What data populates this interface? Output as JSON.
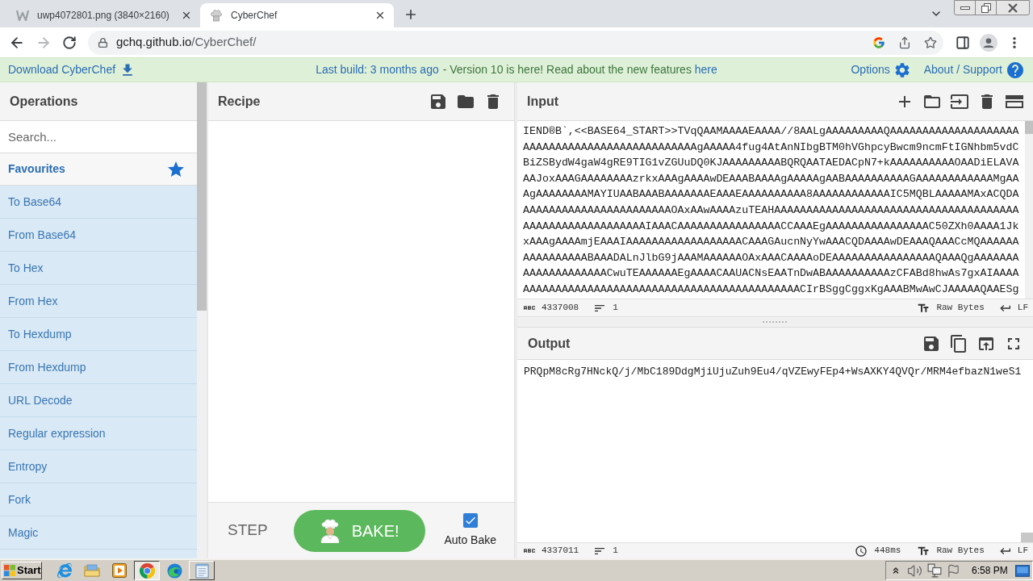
{
  "browser": {
    "tabs": [
      {
        "kind": "image",
        "title": "uwp4072801.png (3840×2160)",
        "selected": false
      },
      {
        "kind": "chef",
        "title": "CyberChef",
        "selected": true
      }
    ],
    "url_host": "gchq.github.io",
    "url_path": "/CyberChef/",
    "forward_disabled": true
  },
  "banner": {
    "download": "Download CyberChef",
    "build": "Last build: 3 months ago",
    "notice": "- Version 10 is here! Read about the new features",
    "notice_link": "here",
    "options": "Options",
    "about": "About / Support"
  },
  "operations": {
    "title": "Operations",
    "search_placeholder": "Search...",
    "favourites": "Favourites",
    "items": [
      "To Base64",
      "From Base64",
      "To Hex",
      "From Hex",
      "To Hexdump",
      "From Hexdump",
      "URL Decode",
      "Regular expression",
      "Entropy",
      "Fork",
      "Magic"
    ]
  },
  "recipe": {
    "title": "Recipe",
    "step": "STEP",
    "bake": "BAKE!",
    "auto_bake": {
      "label": "Auto Bake",
      "checked": true
    }
  },
  "input": {
    "title": "Input",
    "lines": [
      "IEND®B`,<<BASE64_START>>TVqQAAMAAAAEAAAA//8AALgAAAAAAAAAQAAAAAAAAAAAAAAAAAAAA",
      "AAAAAAAAAAAAAAAAAAAAAAAAAAAgAAAAA4fug4AtAnNIbgBTM0hVGhpcyBwcm9ncmFtIGNhbm5vdC",
      "BiZSBydW4gaW4gRE9TIG1vZGUuDQ0KJAAAAAAAAABQRQAATAEDACpN7+kAAAAAAAAAAOAADiELAVA",
      "AAJoxAAAGAAAAAAAAzrkxAAAgAAAAwDEAAABAAAAgAAAAAgAABAAAAAAAAAAGAAAAAAAAAAAAMgAA",
      "AgAAAAAAAAMAYIUAABAAABAAAAAAAEAAAEAAAAAAAAAA8AAAAAAAAAAAAIC5MQBLAAAAAMAxACQDA",
      "AAAAAAAAAAAAAAAAAAAAAAAOAxAAwAAAAzuTEAHAAAAAAAAAAAAAAAAAAAAAAAAAAAAAAAAAAAAAA",
      "AAAAAAAAAAAAAAAAAAAIAAACAAAAAAAAAAAAAAAACCAAAEgAAAAAAAAAAAAAAAAC50ZXh0AAAA1Jk",
      "xAAAgAAAAmjEAAAIAAAAAAAAAAAAAAAAAACAAAGAucnNyYwAAACQDAAAAwDEAAAQAAACcMQAAAAAA",
      "AAAAAAAAAABAAADALnJlbG9jAAAMAAAAAAOAxAAACAAAAoDEAAAAAAAAAAAAAAAAQAAAQgAAAAAAA",
      "AAAAAAAAAAAAACwuTEAAAAAAEgAAAACAAUACNsEAATnDwABAAAAAAAAAAzCFABd8hwAs7gxAIAAAA",
      "AAAAAAAAAAAAAAAAAAAAAAAAAAAAAAAAAAAAAAAAAAACIrBSggCggxKgAAABMwAwCJAAAAAQAAESg"
    ],
    "status": {
      "length": "4337008",
      "lines": "1",
      "encoding": "Raw Bytes",
      "eol": "LF"
    }
  },
  "output": {
    "title": "Output",
    "lines": [
      "PRQpM8cRg7HNckQ/j/MbC189DdgMjiUjuZuh9Eu4/qVZEwyFEp4+WsAXKY4QVQr/MRM4efbazN1weS1"
    ],
    "status": {
      "length": "4337011",
      "lines": "1",
      "time": "448ms",
      "encoding": "Raw Bytes",
      "eol": "LF"
    }
  },
  "taskbar": {
    "start": "Start",
    "apps": [
      {
        "kind": "ie",
        "selected": false,
        "open": false
      },
      {
        "kind": "folder",
        "selected": false,
        "open": false
      },
      {
        "kind": "media",
        "selected": false,
        "open": false
      },
      {
        "kind": "chrome",
        "selected": true,
        "open": true
      },
      {
        "kind": "edge",
        "selected": false,
        "open": false
      },
      {
        "kind": "notepad",
        "selected": false,
        "open": true
      }
    ],
    "clock": "6:58 PM"
  }
}
